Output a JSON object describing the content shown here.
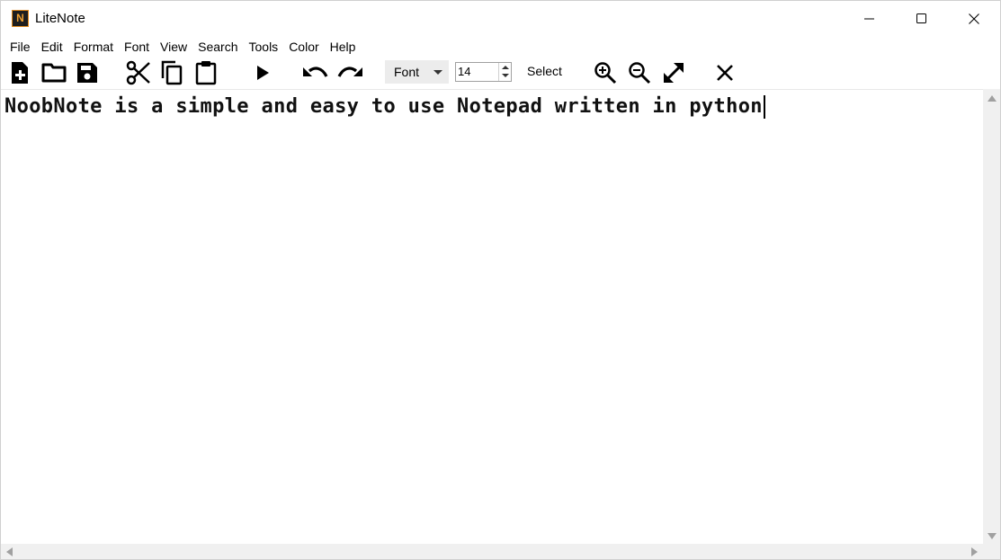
{
  "window": {
    "title": "LiteNote",
    "app_icon_letter": "N",
    "app_icon_color": "#e08a1e"
  },
  "window_controls": [
    "minimize-icon",
    "maximize-icon",
    "close-icon"
  ],
  "menu": [
    {
      "label": "File"
    },
    {
      "label": "Edit"
    },
    {
      "label": "Format"
    },
    {
      "label": "Font"
    },
    {
      "label": "View"
    },
    {
      "label": "Search"
    },
    {
      "label": "Tools"
    },
    {
      "label": "Color"
    },
    {
      "label": "Help"
    }
  ],
  "toolbar": {
    "icons": [
      "new-file-icon",
      "open-folder-icon",
      "save-icon",
      "cut-icon",
      "copy-icon",
      "paste-icon",
      "run-icon",
      "undo-icon",
      "redo-icon",
      "zoom-in-icon",
      "zoom-out-icon",
      "fullscreen-icon",
      "close-icon"
    ],
    "font_select": {
      "value": "Font"
    },
    "font_size": {
      "value": "14"
    },
    "select_label": "Select"
  },
  "editor": {
    "content": "NoobNote is a simple and easy to use Notepad written in python"
  }
}
